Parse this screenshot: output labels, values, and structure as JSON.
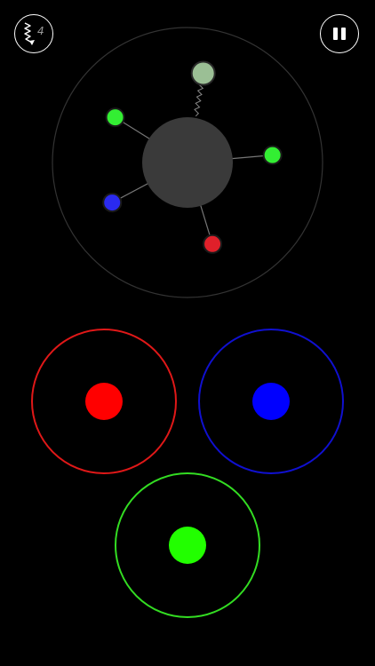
{
  "hud": {
    "power_count": "4",
    "power_icon": "lightning-bolt-arrow-icon",
    "pause_icon": "pause-icon"
  },
  "colors": {
    "red": "#ff0000",
    "blue": "#0000ff",
    "green": "#22ff00",
    "hub": "#3a3a3a",
    "orbit_ring": "#333333",
    "launcher_red_ring": "#e01818",
    "launcher_blue_ring": "#1010d0",
    "launcher_green_ring": "#33dd22",
    "stuck_ball_red": "#e0202a",
    "stuck_ball_blue": "#2a2af0",
    "stuck_ball_green": "#33ee33",
    "next_ball_pending": "#9bbf95"
  },
  "stuck_balls": [
    {
      "color": "green",
      "angle_deg": 148
    },
    {
      "color": "green",
      "angle_deg": 5
    },
    {
      "color": "blue",
      "angle_deg": 208
    },
    {
      "color": "red",
      "angle_deg": 287
    }
  ],
  "pending_ball": {
    "color": "pending",
    "angle_deg": 80
  },
  "launchers": [
    {
      "id": "red",
      "color": "red"
    },
    {
      "id": "blue",
      "color": "blue"
    },
    {
      "id": "green",
      "color": "green"
    }
  ]
}
